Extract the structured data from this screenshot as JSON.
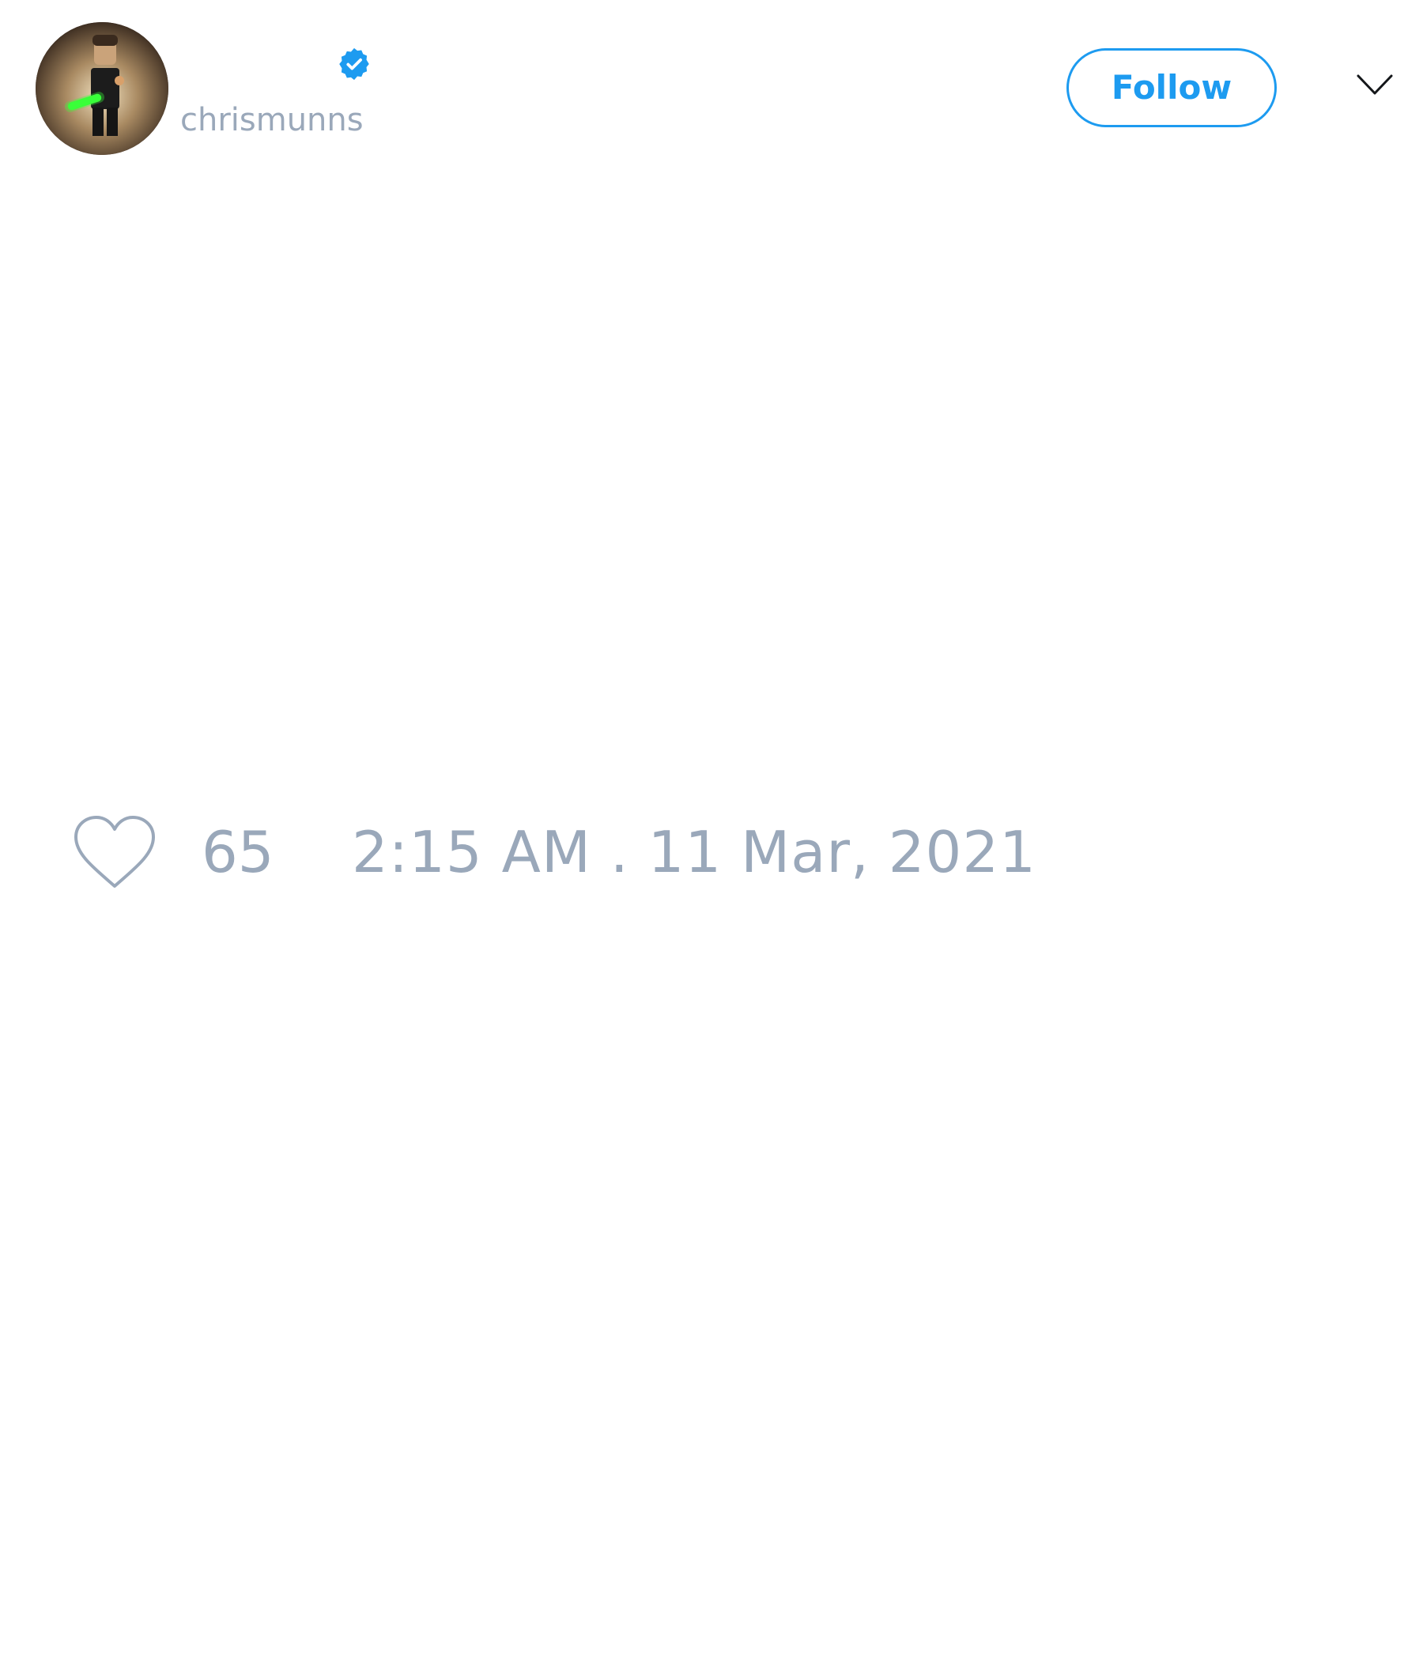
{
  "author": {
    "display_name": "",
    "handle": "chrismunns",
    "verified": true,
    "avatar_icon": "avatar-image"
  },
  "actions": {
    "follow_label": "Follow",
    "menu_icon": "chevron-down-icon"
  },
  "tweet": {
    "like_icon": "heart-outline-icon",
    "like_count": "65",
    "timestamp": "2:15 AM . 11 Mar, 2021"
  },
  "colors": {
    "accent": "#1d9bf0",
    "muted_text": "#9aa8ba",
    "background": "#ffffff"
  }
}
